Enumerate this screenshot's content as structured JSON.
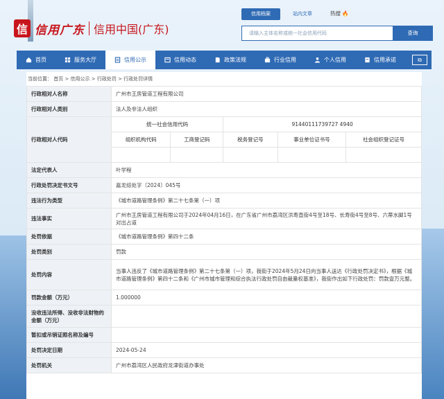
{
  "header": {
    "logo_char": "信",
    "logo_script": "信用广东",
    "logo_text": "信用中国(广东)",
    "search_tabs": [
      "信用档案",
      "站内文章"
    ],
    "hot_label": "热搜",
    "search_placeholder": "请输入主体名称或统一社会信用代码",
    "search_button": "查询"
  },
  "nav": {
    "items": [
      {
        "label": "首页",
        "icon": "home-icon"
      },
      {
        "label": "服务大厅",
        "icon": "service-icon"
      },
      {
        "label": "信用公示",
        "icon": "publicity-icon",
        "active": true
      },
      {
        "label": "信用动态",
        "icon": "news-icon"
      },
      {
        "label": "政策法规",
        "icon": "policy-icon"
      },
      {
        "label": "行业信用",
        "icon": "industry-icon"
      },
      {
        "label": "个人信用",
        "icon": "person-icon"
      },
      {
        "label": "信用承诺",
        "icon": "promise-icon"
      }
    ],
    "extra": "⧉"
  },
  "breadcrumb": "当前位置： 首页 > 信用公示 > 行政处罚 > 行政处罚详情",
  "detail": {
    "name_label": "行政相对人名称",
    "name_value": "广州市王房管道工程有限公司",
    "type_label": "行政相对人类别",
    "type_value": "法人及非法人组织",
    "code_label": "行政相对人代码",
    "uscc_label": "统一社会信用代码",
    "uscc_value": "91440111739727 4940",
    "sub_headers": [
      "组织机构代码",
      "工商登记码",
      "税务登记号",
      "事业单位证书号",
      "社会组织登记证号"
    ],
    "rep_label": "法定代表人",
    "rep_value": "叶学程",
    "doc_label": "行政处罚决定书文号",
    "doc_value": "嘉龙综处字〔2024〕045号",
    "viol_type_label": "违法行为类型",
    "viol_type_value": "《城市道路管理条例》第二十七条第（一）项",
    "facts_label": "违法事实",
    "facts_value": "广州市王房管道工程有限公司于2024年04月16日，在广东省广州市荔湾区洪寿直街4号至18号、长寿街4号至8号、六蒂水脚1号对出占道",
    "basis_label": "处罚依据",
    "basis_value": "《城市道路管理条例》第四十二条",
    "category_label": "处罚类别",
    "category_value": "罚款",
    "content_label": "处罚内容",
    "content_value": "当事人违反了《城市道路管理条例》第二十七条第（一）项，我街于2024年5月24日向当事人送达《行政处罚决定书》，根据《城市道路管理条例》第四十二条和《广州市城市管理和综合执法行政处罚自由裁量权基准》，我街作出如下行政处罚：罚款壹万元整。",
    "amount_label": "罚款金额（万元）",
    "amount_value": "1.000000",
    "confiscate_label": "没收违法所得、没收非法财物的金额（万元）",
    "confiscate_value": "",
    "license_label": "暂扣或吊销证照名称及编号",
    "license_value": "",
    "date_label": "处罚决定日期",
    "date_value": "2024-05-24",
    "org_label": "处罚机关",
    "org_value": "广州市荔湾区人民政府龙津街道办事处"
  },
  "colors": {
    "brand_blue": "#2f6ab4",
    "logo_red": "#c8161d",
    "label_bg": "#eef2f7"
  }
}
